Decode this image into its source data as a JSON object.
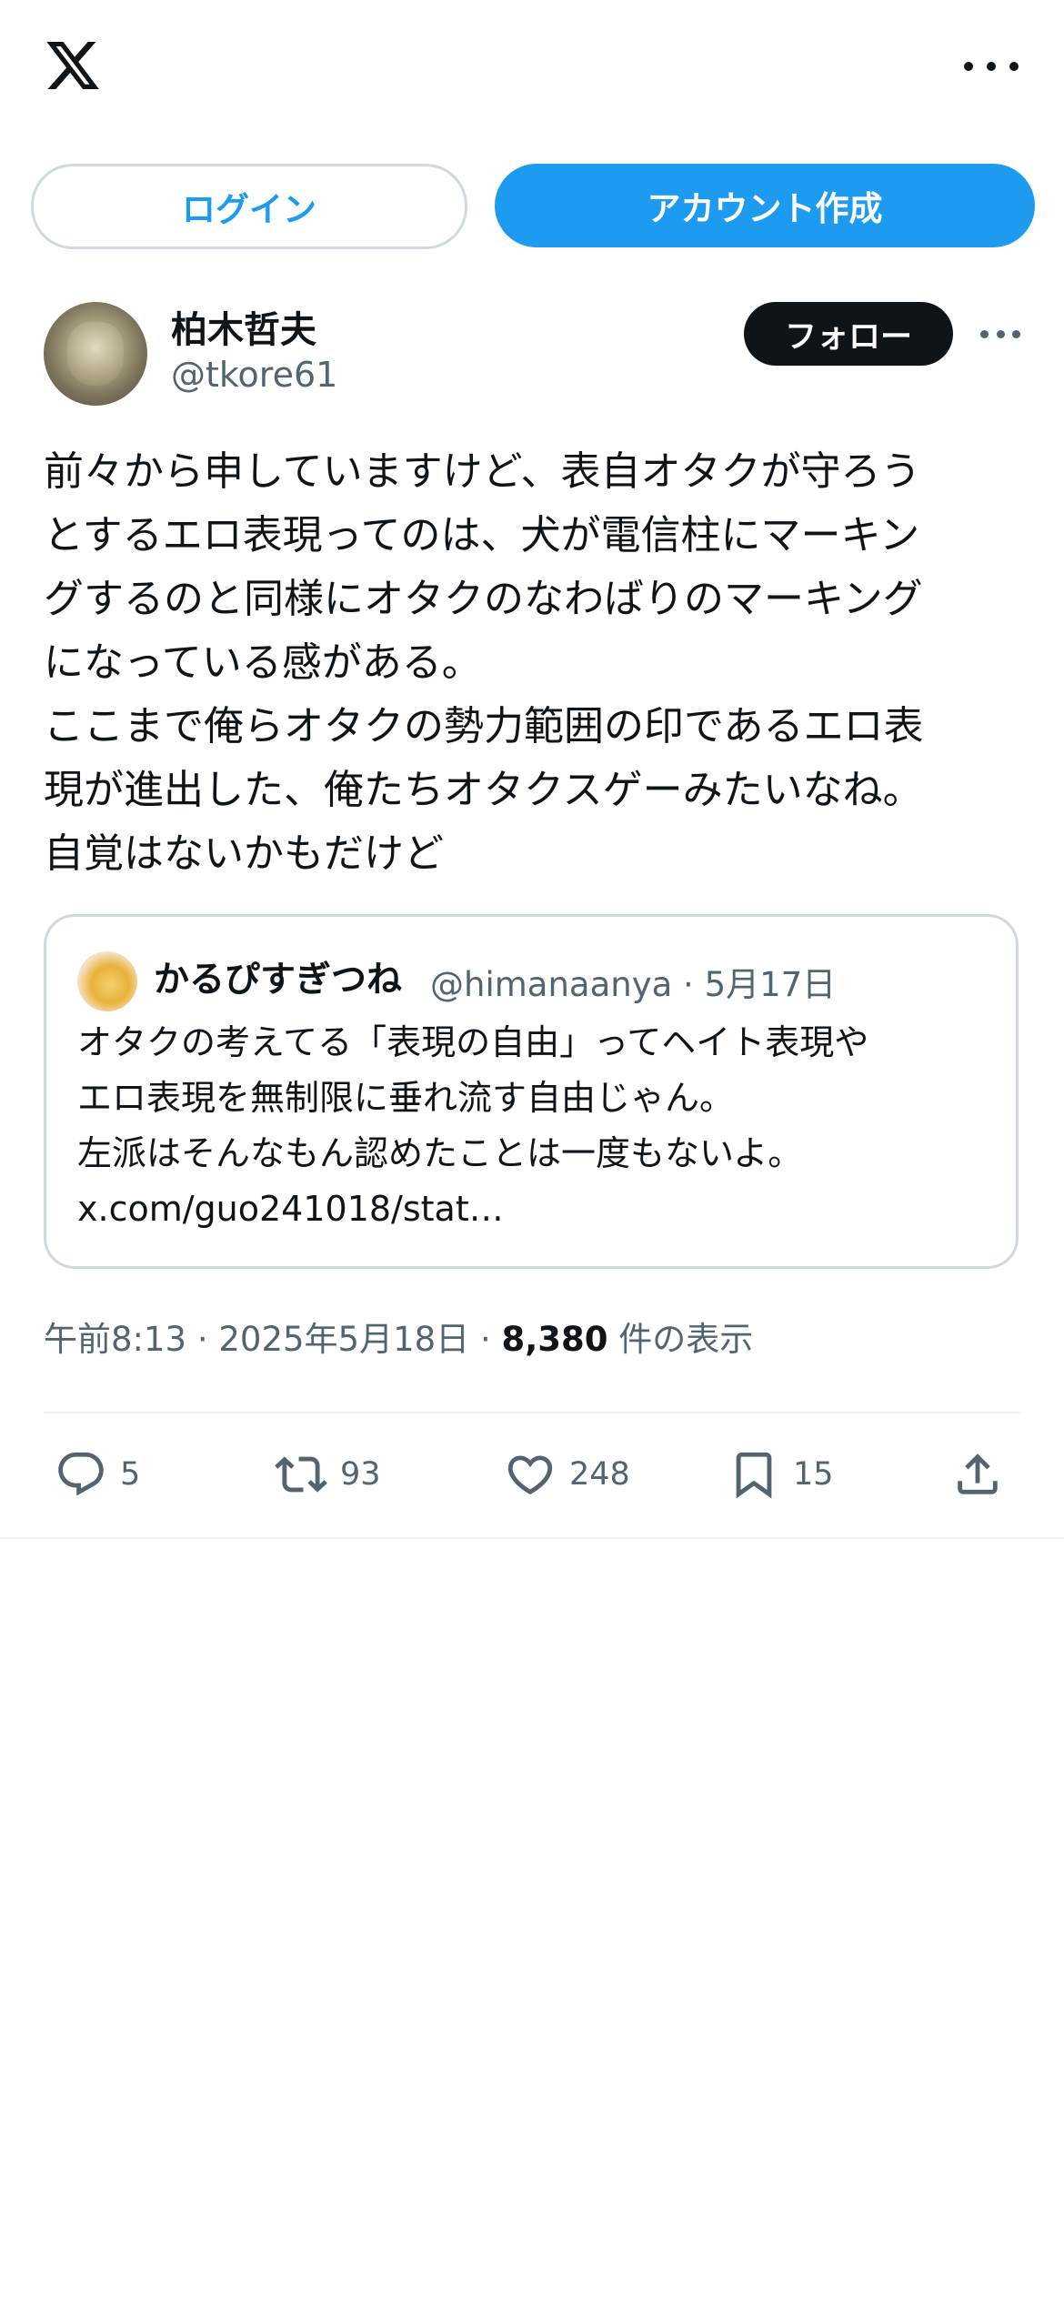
{
  "header": {
    "logo_icon": "x-logo-icon",
    "more_icon": "more-horizontal-icon"
  },
  "auth": {
    "login_label": "ログイン",
    "signup_label": "アカウント作成"
  },
  "author": {
    "display_name": "柏木哲夫",
    "handle": "@tkore61",
    "follow_label": "フォロー"
  },
  "tweet": {
    "lines": [
      "前々から申していますけど、表自オタクが守ろう",
      "とするエロ表現ってのは、犬が電信柱にマーキン",
      "グするのと同様にオタクのなわばりのマーキング",
      "になっている感がある。",
      "ここまで俺らオタクの勢力範囲の印であるエロ表",
      "現が進出した、俺たちオタクスゲーみたいなね。",
      "自覚はないかもだけど"
    ]
  },
  "quote": {
    "display_name": "かるぴすぎつね",
    "handle": "@himanaanya",
    "separator": "·",
    "date": "5月17日",
    "lines": [
      "オタクの考えてる「表現の自由」ってヘイト表現や",
      "エロ表現を無制限に垂れ流す自由じゃん。",
      "左派はそんなもん認めたことは一度もないよ。",
      "x.com/guo241018/stat…"
    ]
  },
  "meta": {
    "time": "午前8:13",
    "separator": "·",
    "date": "2025年5月18日",
    "views_count": "8,380",
    "views_label": "件の表示"
  },
  "actions": {
    "reply_count": "5",
    "retweet_count": "93",
    "like_count": "248",
    "bookmark_count": "15"
  },
  "colors": {
    "accent": "#1d9bf0",
    "text": "#0f1419",
    "secondary": "#536471",
    "border": "#cfd9de"
  }
}
